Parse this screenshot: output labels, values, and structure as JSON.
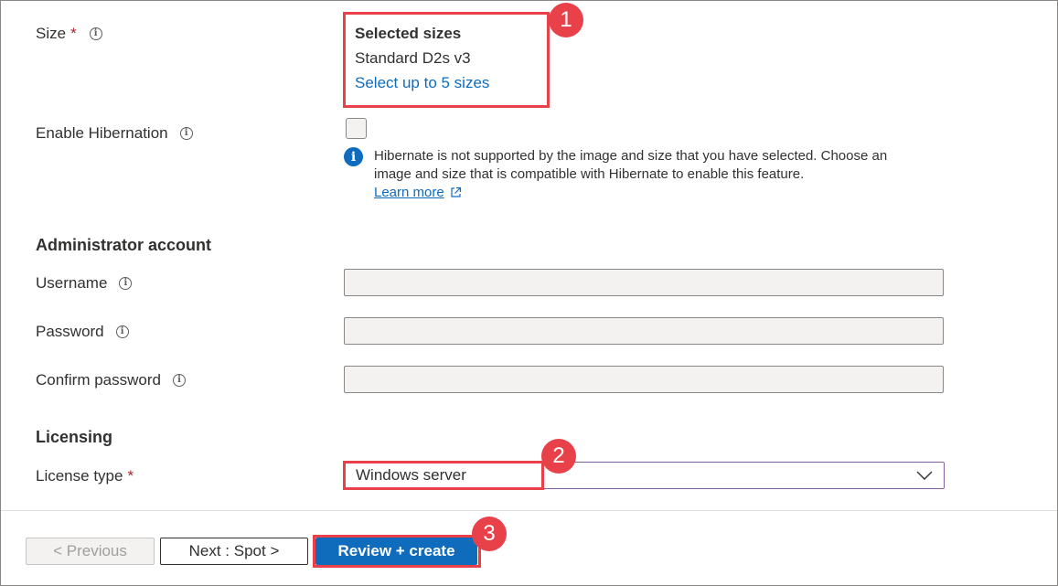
{
  "size": {
    "label": "Size",
    "required_mark": "*",
    "selected_heading": "Selected sizes",
    "selected_value": "Standard D2s v3",
    "select_link": "Select up to 5 sizes"
  },
  "hibernation": {
    "label": "Enable Hibernation",
    "checked": false,
    "info_text_line1": "Hibernate is not supported by the image and size that you have selected. Choose an",
    "info_text_line2": "image and size that is compatible with Hibernate to enable this feature.",
    "learn_more": "Learn more"
  },
  "admin": {
    "heading": "Administrator account",
    "username_label": "Username",
    "password_label": "Password",
    "confirm_label": "Confirm password"
  },
  "licensing": {
    "heading": "Licensing",
    "license_type_label": "License type",
    "required_mark": "*",
    "license_type_value": "Windows server"
  },
  "footer": {
    "previous_label": "< Previous",
    "next_label": "Next : Spot >",
    "review_label": "Review + create"
  },
  "callouts": {
    "one": "1",
    "two": "2",
    "three": "3"
  },
  "icons": {
    "info": "info-circle-icon",
    "info_filled": "info-filled-icon",
    "external": "external-link-icon",
    "chevron": "chevron-down-icon"
  },
  "colors": {
    "accent": "#0f6cbd",
    "callout": "#e8414a",
    "required": "#a4262c",
    "primary_button": "#0f6cbd"
  }
}
